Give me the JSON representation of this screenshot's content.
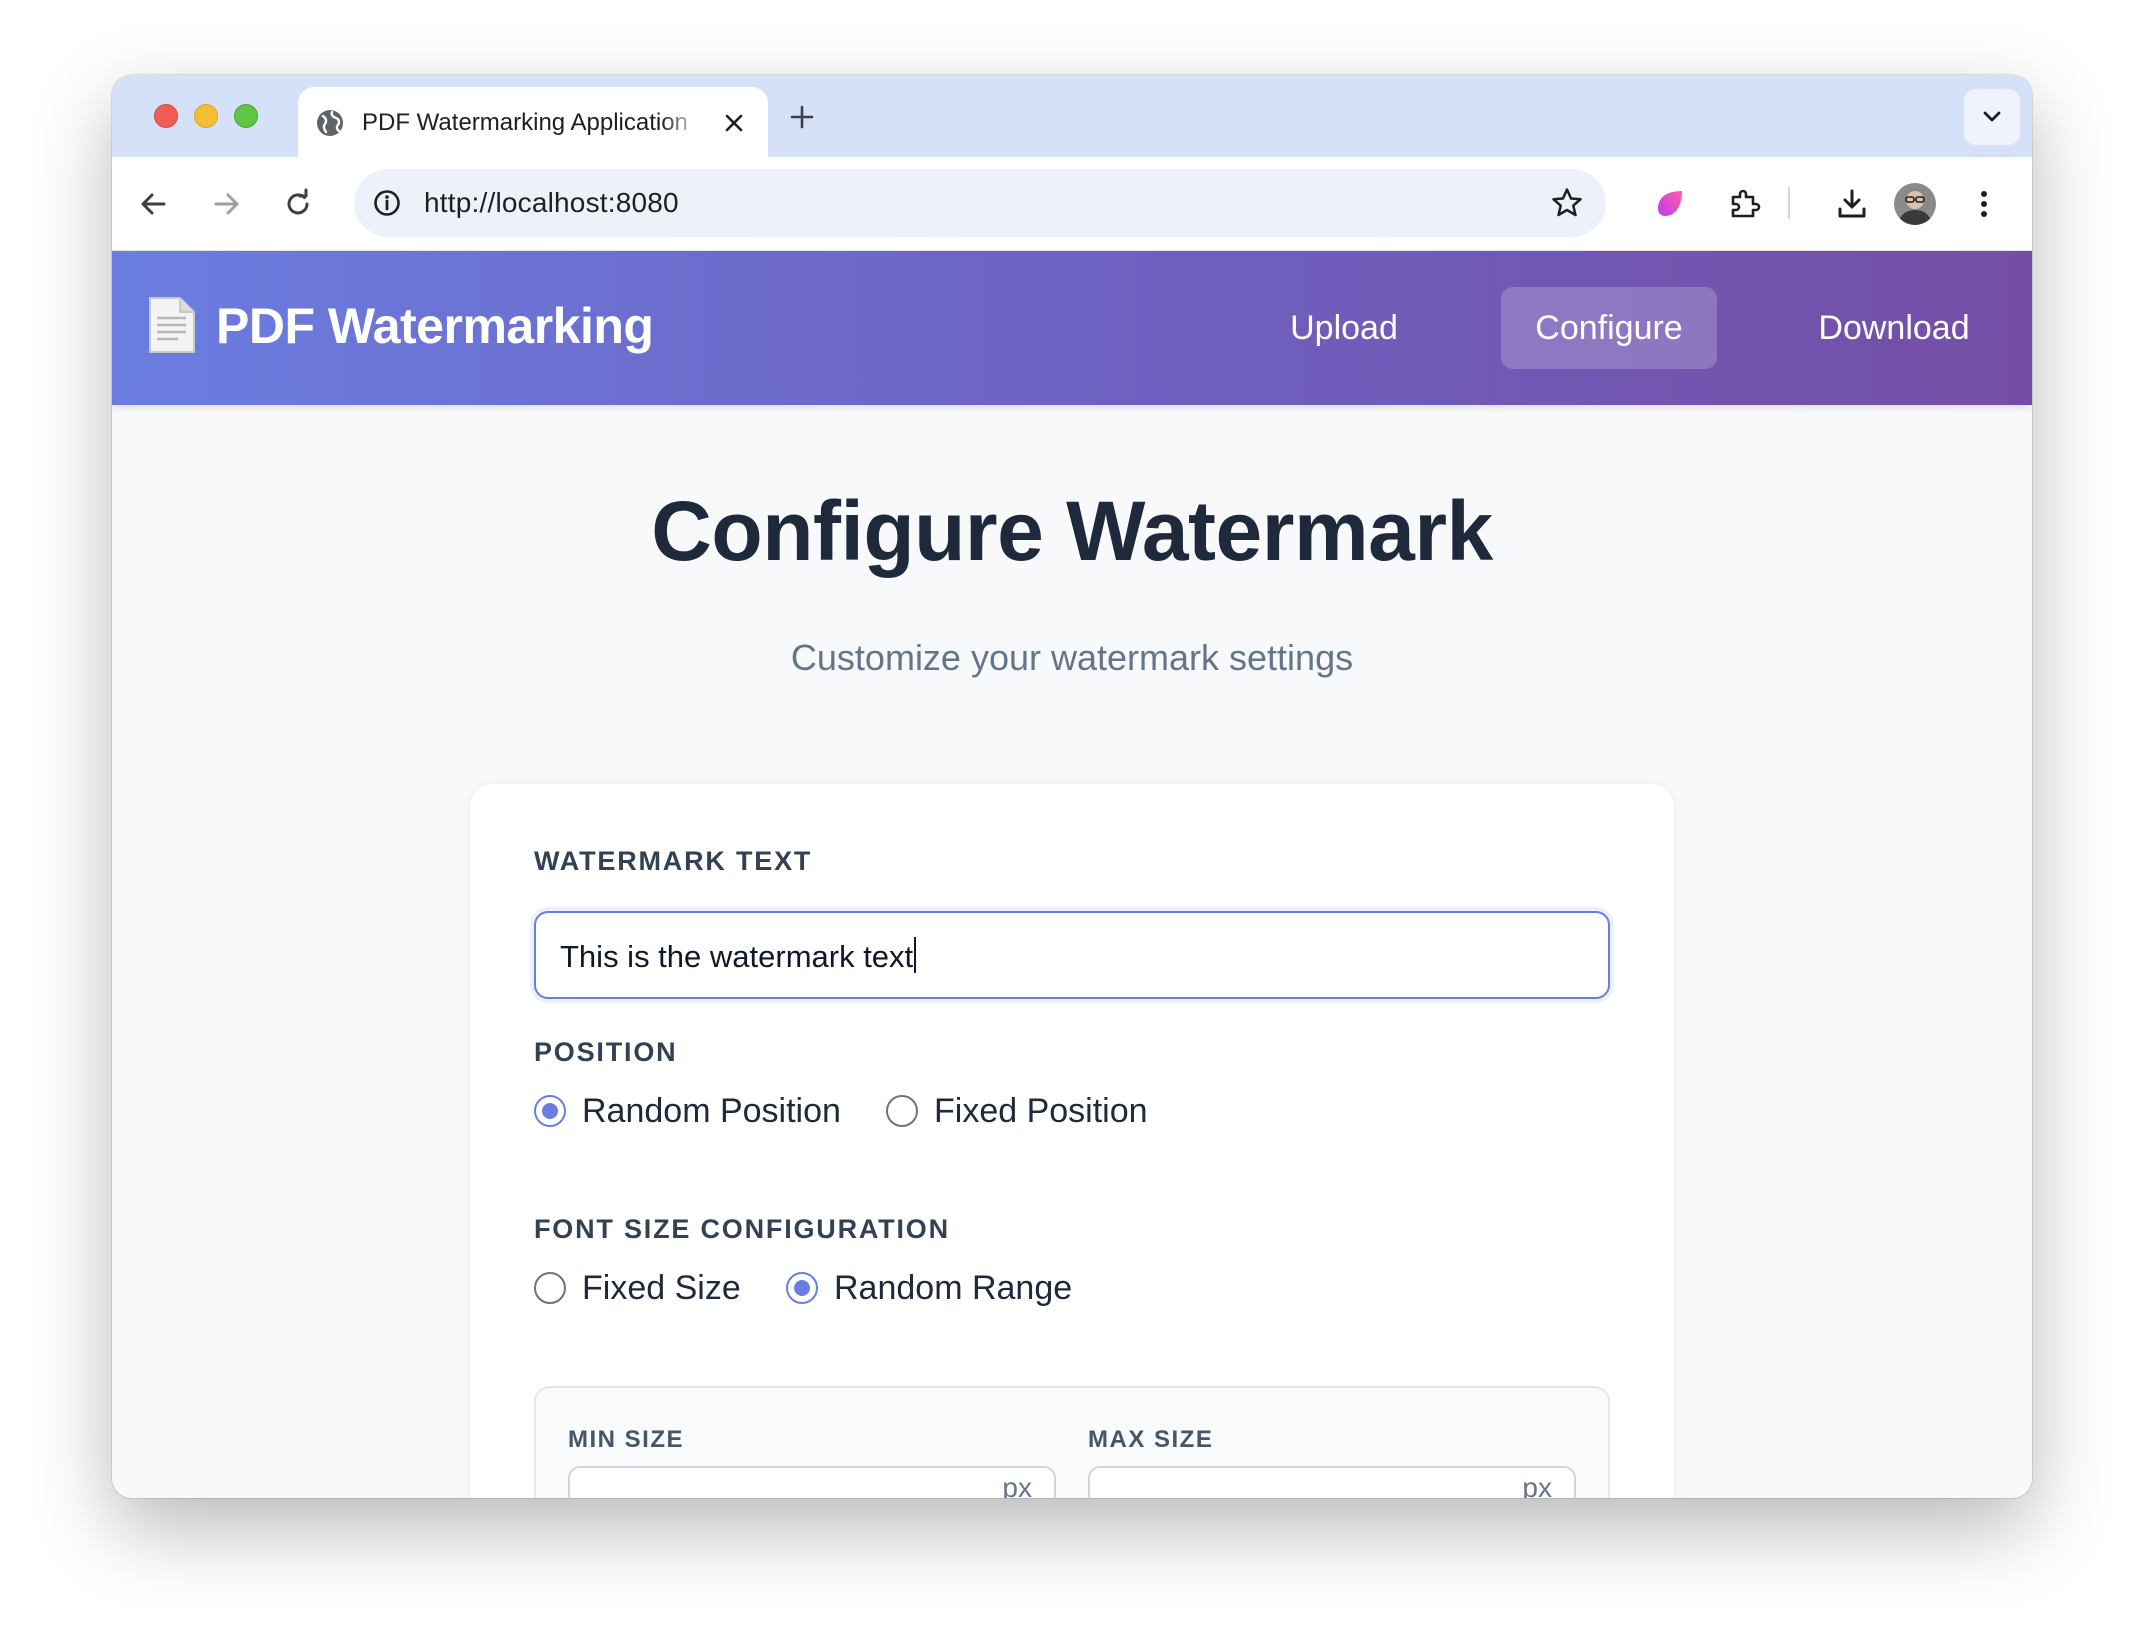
{
  "browser": {
    "tab_title": "PDF Watermarking Application",
    "url": "http://localhost:8080"
  },
  "navbar": {
    "brand": "PDF Watermarking",
    "brand_icon": "document-icon",
    "links": [
      "Upload",
      "Configure",
      "Download"
    ],
    "active_link": "Configure"
  },
  "header": {
    "title": "Configure Watermark",
    "subtitle": "Customize your watermark settings"
  },
  "form": {
    "watermark_text": {
      "label": "WATERMARK TEXT",
      "value": "This is the watermark text"
    },
    "position": {
      "label": "POSITION",
      "options": [
        "Random Position",
        "Fixed Position"
      ],
      "selected": "Random Position"
    },
    "font_size": {
      "label": "FONT SIZE CONFIGURATION",
      "options": [
        "Fixed Size",
        "Random Range"
      ],
      "selected": "Random Range",
      "min": {
        "label": "MIN SIZE",
        "unit": "px"
      },
      "max": {
        "label": "MAX SIZE",
        "unit": "px"
      }
    }
  },
  "colors": {
    "accent": "#6a7ee0",
    "gradient_start": "#6a7ee0",
    "gradient_end": "#744ea6",
    "title": "#1e293b",
    "muted": "#64748b"
  }
}
